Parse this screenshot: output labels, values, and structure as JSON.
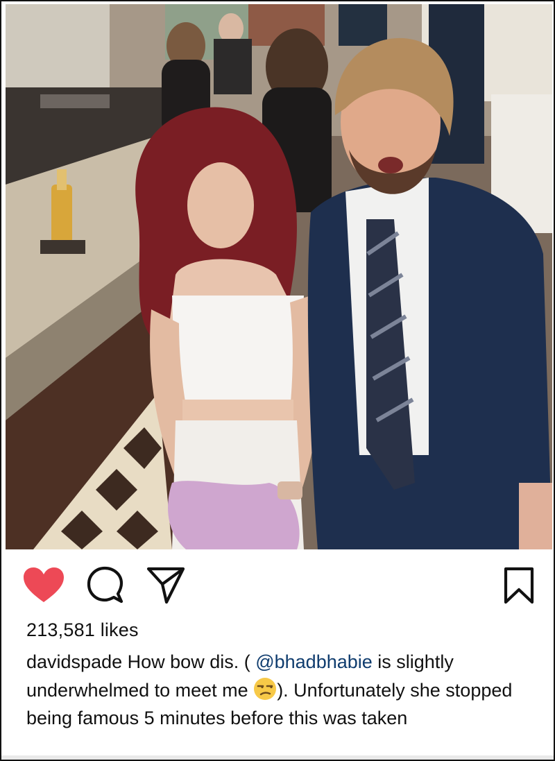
{
  "post": {
    "photo_alt": "Photo",
    "likes_text": "213,581 likes",
    "caption": {
      "username": "davidspade",
      "text_1": "How bow dis. (",
      "mention": "@bhadbhabie",
      "text_2": "is slightly underwhelmed to meet me",
      "emoji": "unamused-face",
      "text_3": "). Unfortunately she stopped being famous 5 minutes before this was taken"
    }
  },
  "actions": {
    "like_icon": "heart-filled-icon",
    "comment_icon": "comment-icon",
    "share_icon": "send-icon",
    "save_icon": "bookmark-icon",
    "like_color": "#ed4956"
  }
}
